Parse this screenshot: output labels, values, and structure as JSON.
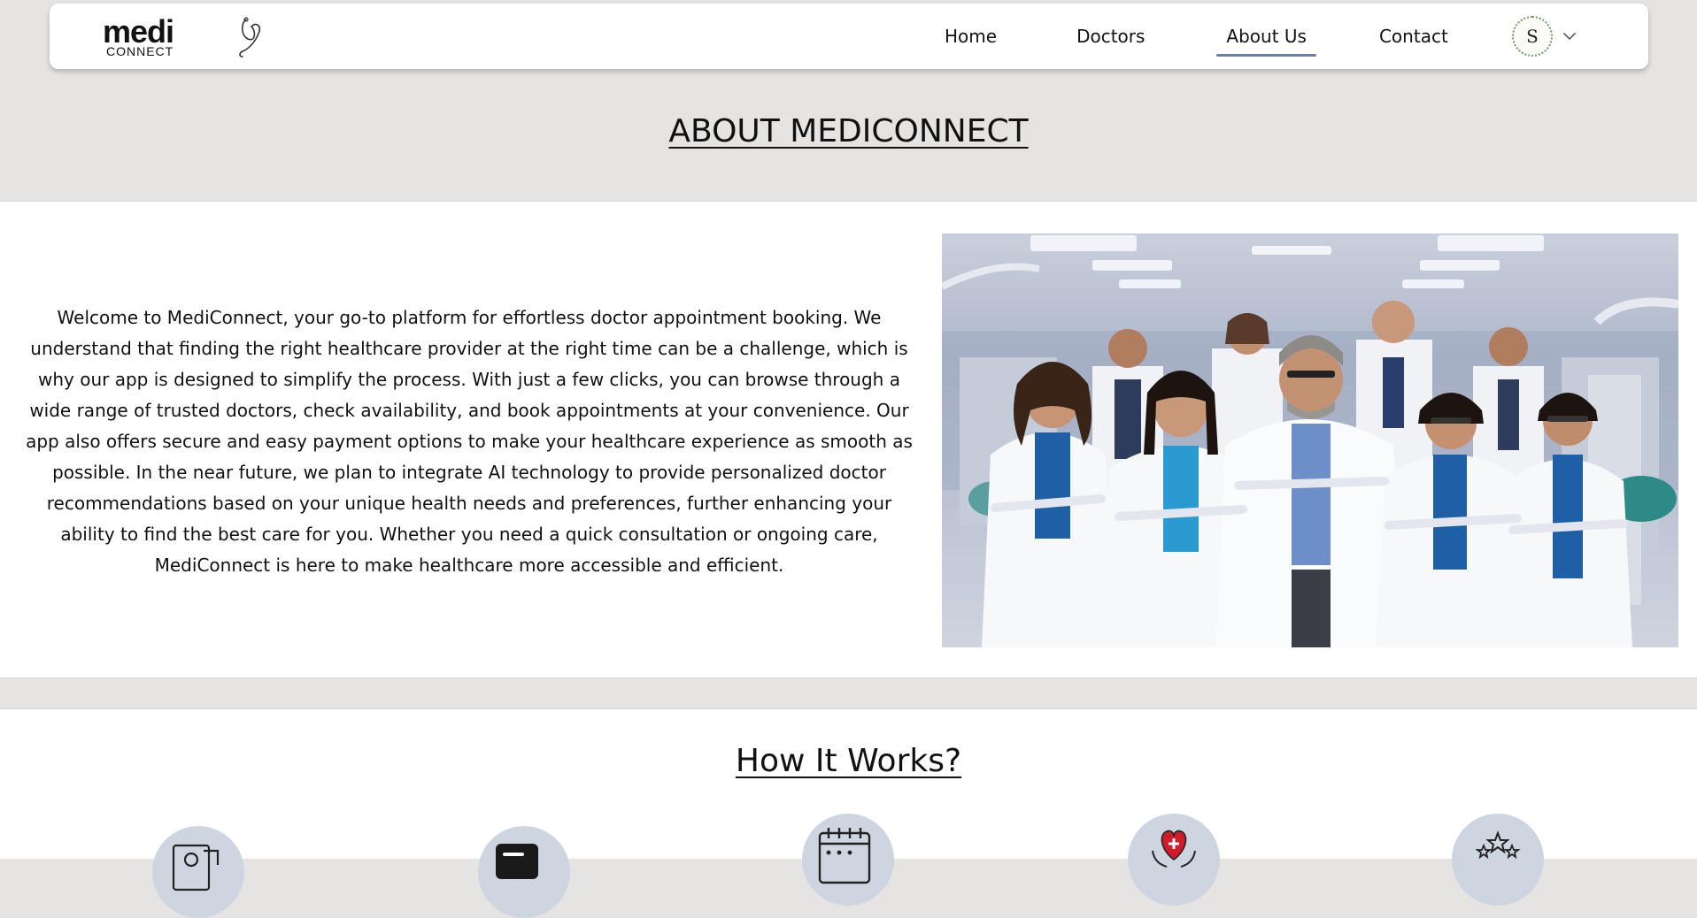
{
  "brand": {
    "logo_text": "medi",
    "logo_subtext": "CONNECT"
  },
  "nav": {
    "items": [
      {
        "label": "Home"
      },
      {
        "label": "Doctors"
      },
      {
        "label": "About Us"
      },
      {
        "label": "Contact"
      }
    ],
    "active": "About Us",
    "avatar_initial": "S"
  },
  "about": {
    "title": "ABOUT MEDICONNECT",
    "body": "Welcome to MediConnect, your go-to platform for effortless doctor appointment booking. We understand that finding the right healthcare provider at the right time can be a challenge, which is why our app is designed to simplify the process. With just a few clicks, you can browse through a wide range of trusted doctors, check availability, and book appointments at your convenience. Our app also offers secure and easy payment options to make your healthcare experience as smooth as possible. In the near future, we plan to integrate AI technology to provide personalized doctor recommendations based on your unique health needs and preferences, further enhancing your ability to find the best care for you. Whether you need a quick consultation or ongoing care, MediConnect is here to make healthcare more accessible and efficient."
  },
  "how_it_works": {
    "title": "How It Works?",
    "steps": [
      {
        "icon": "doctor-profile-icon"
      },
      {
        "icon": "card-icon"
      },
      {
        "icon": "calendar-icon"
      },
      {
        "icon": "heart-hands-icon"
      },
      {
        "icon": "stars-icon"
      }
    ]
  },
  "colors": {
    "page_bg": "#e5e4e2",
    "nav_underline": "#6a7fa8",
    "icon_circle": "#cdd5e0",
    "heart_red": "#d01c2a"
  }
}
